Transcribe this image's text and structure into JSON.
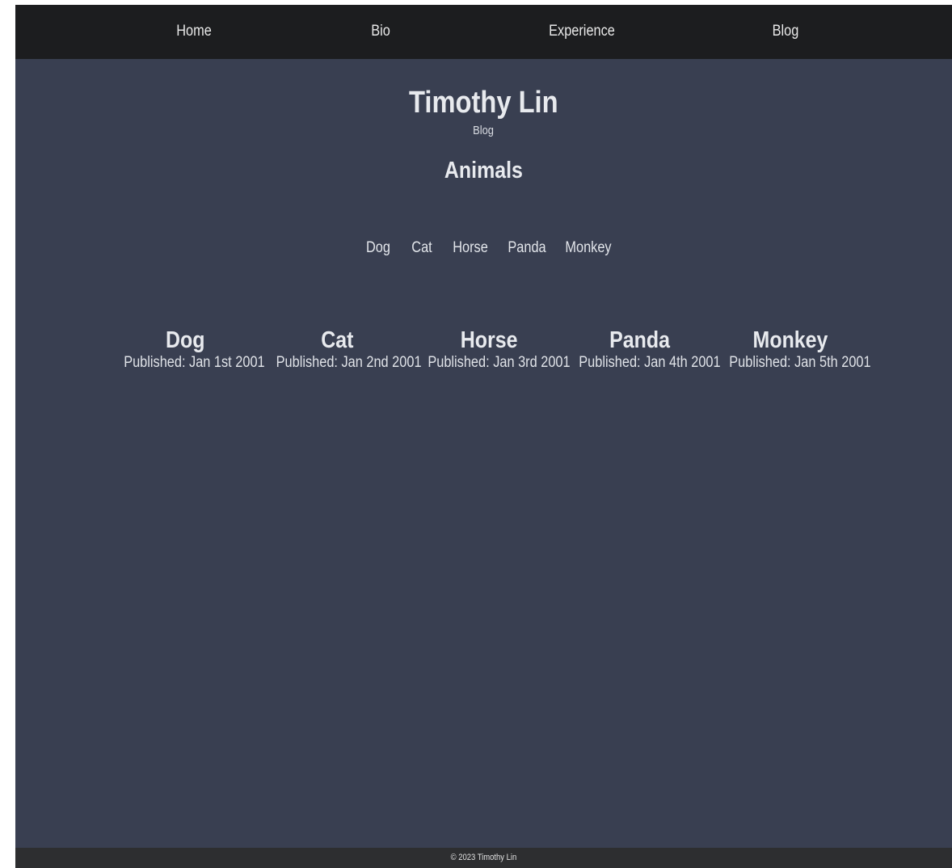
{
  "nav": {
    "home": "Home",
    "bio": "Bio",
    "experience": "Experience",
    "blog": "Blog"
  },
  "header": {
    "title": "Timothy Lin",
    "subtitle": "Blog"
  },
  "section": {
    "title": "Animals"
  },
  "topics": [
    "Dog",
    "Cat",
    "Horse",
    "Panda",
    "Monkey"
  ],
  "posts": [
    {
      "title": "Dog",
      "date": "Published: Jan 1st 2001"
    },
    {
      "title": "Cat",
      "date": "Published: Jan 2nd 2001"
    },
    {
      "title": "Horse",
      "date": "Published: Jan 3rd 2001"
    },
    {
      "title": "Panda",
      "date": "Published: Jan 4th 2001"
    },
    {
      "title": "Monkey",
      "date": "Published: Jan 5th 2001"
    }
  ],
  "footer": {
    "copyright": "© 2023 Timothy Lin"
  },
  "colors": {
    "background": "#393f51",
    "navbar": "#1c1d1f",
    "footer": "#2d2e30",
    "text": "#e6e8ec"
  }
}
